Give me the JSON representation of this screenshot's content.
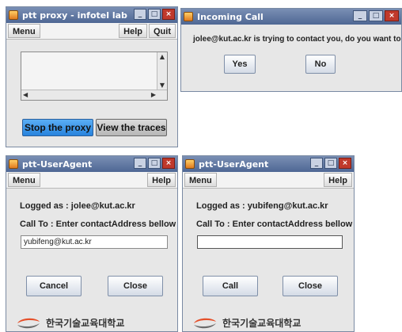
{
  "proxy_window": {
    "title": "ptt proxy - infotel lab",
    "menu_label": "Menu",
    "help_label": "Help",
    "quit_label": "Quit",
    "stop_button": "Stop the proxy",
    "traces_button": "View the traces",
    "min_glyph": "_",
    "max_glyph": "□",
    "close_glyph": "×"
  },
  "call_dialog": {
    "title": "Incoming Call",
    "message": "jolee@kut.ac.kr is trying to contact you, do you want to answer ?",
    "yes_label": "Yes",
    "no_label": "No"
  },
  "useragent_left": {
    "title": "ptt-UserAgent",
    "menu_label": "Menu",
    "help_label": "Help",
    "logged_as": "Logged as :  jolee@kut.ac.kr",
    "call_to": "Call To :   Enter contactAddress bellow !",
    "address_value": "yubifeng@kut.ac.kr",
    "cancel_label": "Cancel",
    "close_label": "Close",
    "logo_text": "한국기술교육대학교"
  },
  "useragent_right": {
    "title": "ptt-UserAgent",
    "menu_label": "Menu",
    "help_label": "Help",
    "logged_as": "Logged as :  yubifeng@kut.ac.kr",
    "call_to": "Call To :   Enter contactAddress bellow !",
    "address_value": "",
    "call_label": "Call",
    "close_label": "Close",
    "logo_text": "한국기술교육대학교"
  },
  "colors": {
    "titlebar": "#5a74a0",
    "window_bg": "#e7e7e7",
    "stop_button": "#3a8ee6",
    "close_control": "#c0392b"
  },
  "icons": [
    "java-app-icon",
    "scroll-up-icon",
    "scroll-down-icon",
    "scroll-left-icon",
    "scroll-right-icon",
    "university-logo"
  ]
}
